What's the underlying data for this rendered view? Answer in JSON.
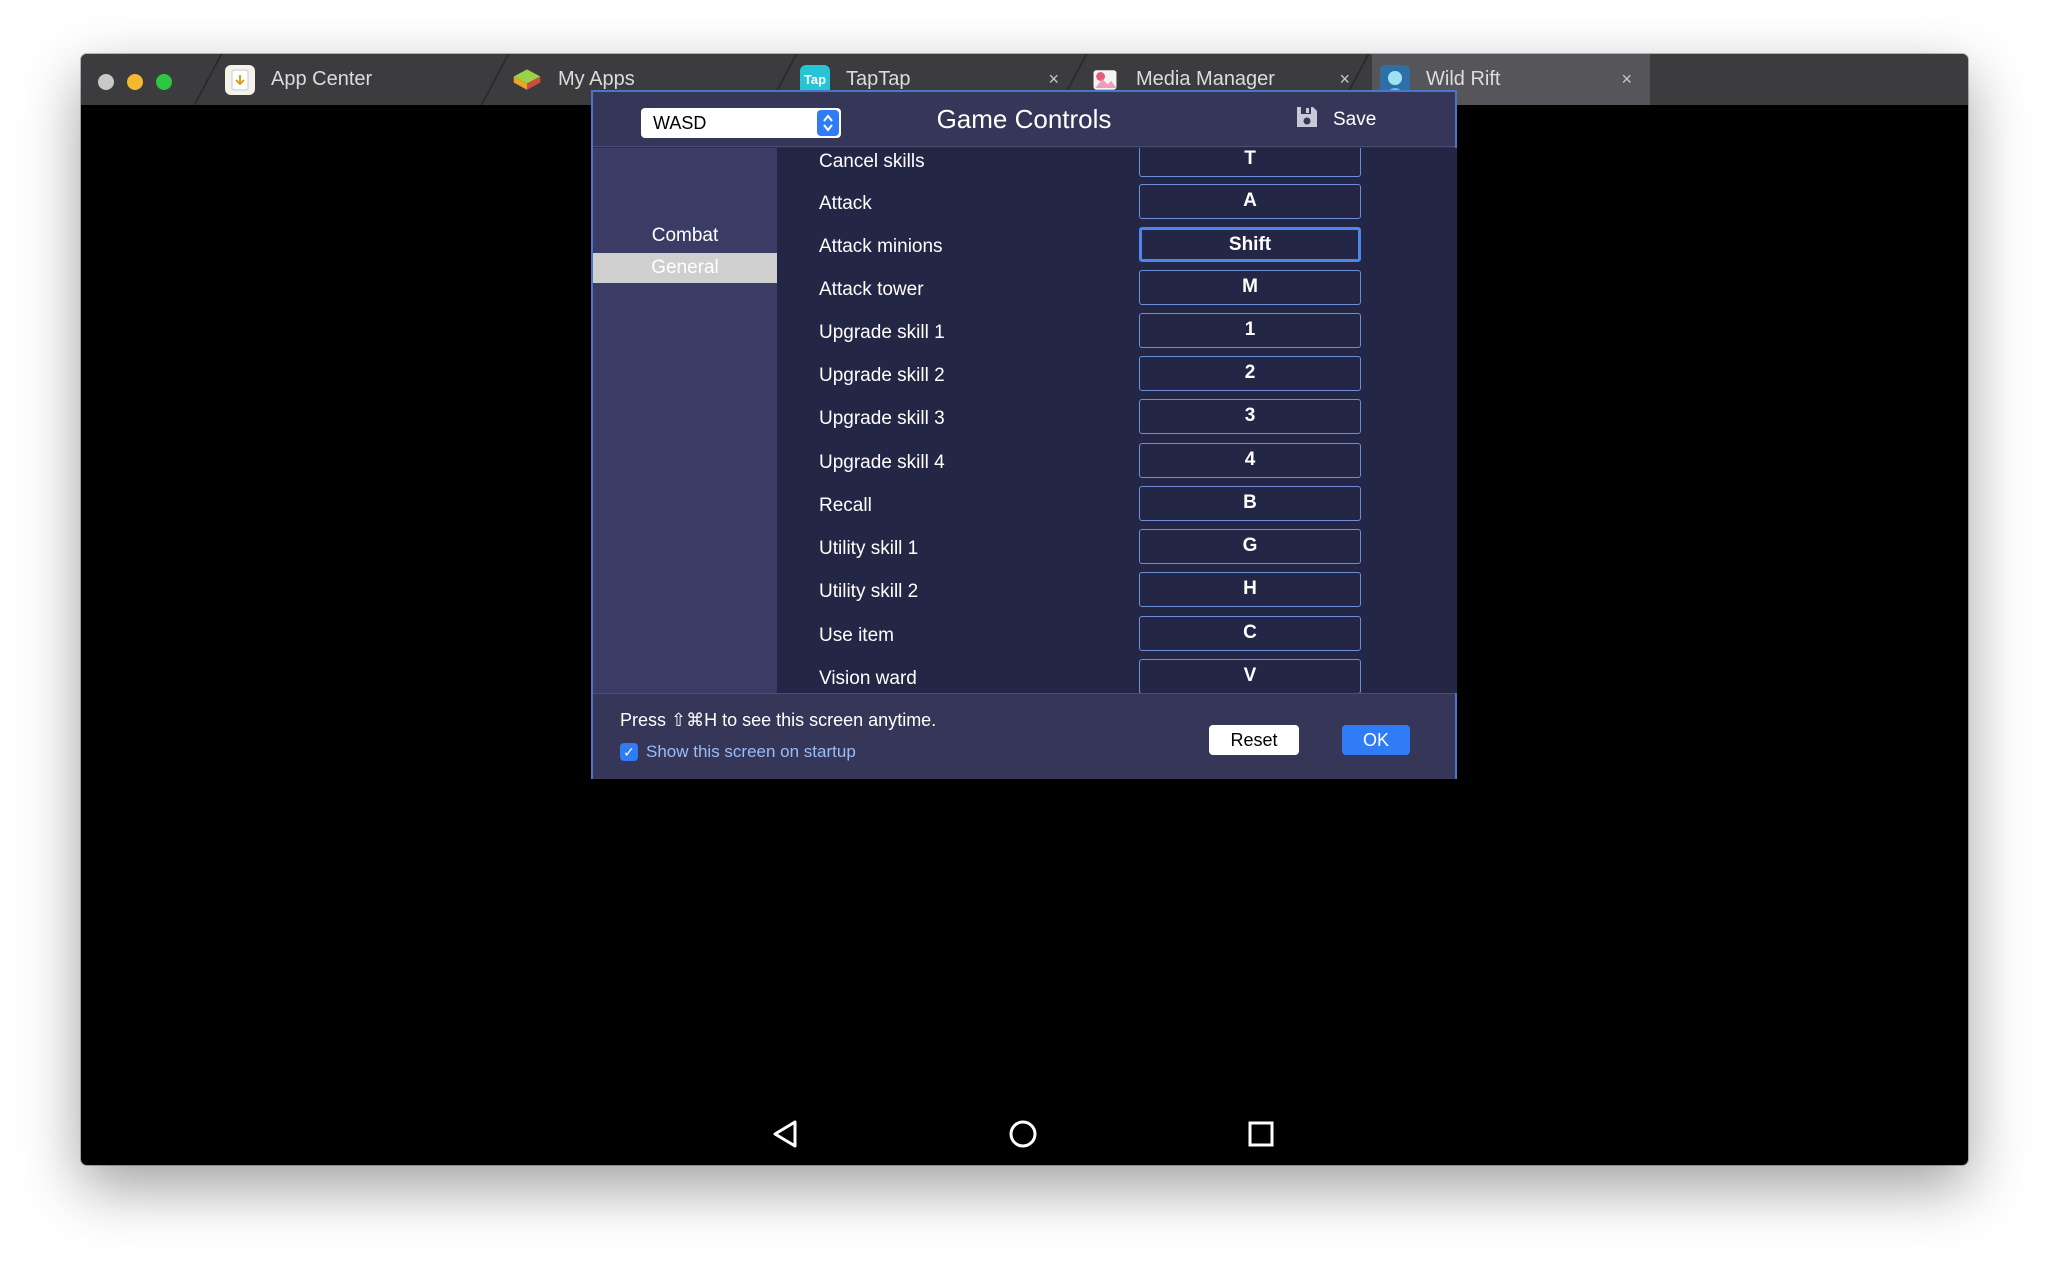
{
  "window": {
    "tabs": [
      {
        "label": "App Center",
        "closable": false,
        "active": false,
        "icon": "app-center-icon"
      },
      {
        "label": "My Apps",
        "closable": false,
        "active": false,
        "icon": "my-apps-icon"
      },
      {
        "label": "TapTap",
        "closable": true,
        "active": false,
        "icon": "taptap-icon",
        "icon_text": "Tap"
      },
      {
        "label": "Media Manager",
        "closable": true,
        "active": false,
        "icon": "media-manager-icon"
      },
      {
        "label": "Wild Rift",
        "closable": true,
        "active": true,
        "icon": "wild-rift-icon"
      }
    ],
    "close_glyph": "×"
  },
  "dialog": {
    "preset": {
      "value": "WASD"
    },
    "title": "Game Controls",
    "save_label": "Save",
    "categories": [
      {
        "label": "Combat",
        "selected": false
      },
      {
        "label": "General",
        "selected": true
      }
    ],
    "controls": [
      {
        "label": "Cancel skills",
        "key": "T"
      },
      {
        "label": "Attack",
        "key": "A"
      },
      {
        "label": "Attack minions",
        "key": "Shift",
        "focused": true
      },
      {
        "label": "Attack tower",
        "key": "M"
      },
      {
        "label": "Upgrade skill 1",
        "key": "1"
      },
      {
        "label": "Upgrade skill 2",
        "key": "2"
      },
      {
        "label": "Upgrade skill 3",
        "key": "3"
      },
      {
        "label": "Upgrade skill 4",
        "key": "4"
      },
      {
        "label": "Recall",
        "key": "B"
      },
      {
        "label": "Utility skill 1",
        "key": "G"
      },
      {
        "label": "Utility skill 2",
        "key": "H"
      },
      {
        "label": "Use item",
        "key": "C"
      },
      {
        "label": "Vision ward",
        "key": "V"
      }
    ],
    "hint": "Press ⇧⌘H to see this screen anytime.",
    "startup_label": "Show this screen on startup",
    "startup_checked": true,
    "reset_label": "Reset",
    "ok_label": "OK"
  },
  "colors": {
    "accent": "#2f7cf6",
    "dialog_border": "#4a76c8",
    "dialog_bg": "#242645"
  }
}
